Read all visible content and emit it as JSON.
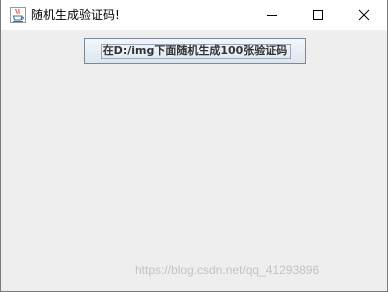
{
  "window": {
    "title": "随机生成验证码!",
    "app_icon": "java-coffee-cup-icon",
    "controls": {
      "minimize_icon": "minimize-icon",
      "maximize_icon": "maximize-icon",
      "close_icon": "close-icon"
    }
  },
  "main": {
    "generate_button_label": "在D:/img下面随机生成100张验证码"
  },
  "watermark": "https://blog.csdn.net/qq_41293896",
  "colors": {
    "title_bar": "#ffffff",
    "client_background": "#eeeeee",
    "button_border": "#7a8a99"
  }
}
